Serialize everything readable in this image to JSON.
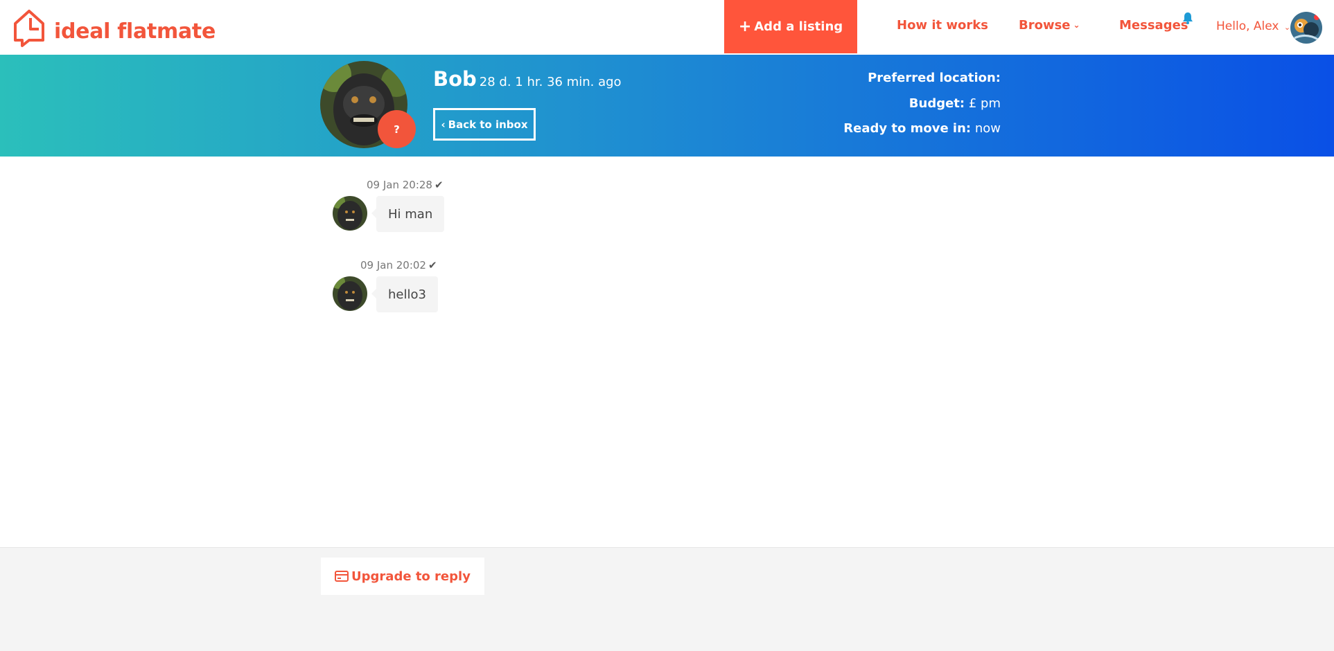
{
  "brand": {
    "name": "ideal flatmate",
    "color": "#f2553b"
  },
  "nav": {
    "add_listing": "Add a listing",
    "how_it_works": "How it works",
    "browse": "Browse",
    "messages": "Messages",
    "greeting": "Hello, Alex"
  },
  "conversation": {
    "contact_name": "Bob",
    "last_seen": "28 d. 1 hr. 36 min. ago",
    "badge": "?",
    "back_label": "Back to inbox",
    "preferred_location_label": "Preferred location:",
    "preferred_location_value": "",
    "budget_label": "Budget:",
    "budget_value": "£ pm",
    "move_in_label": "Ready to move in:",
    "move_in_value": "now"
  },
  "messages": [
    {
      "time": "09 Jan 20:28",
      "text": "Hi man"
    },
    {
      "time": "09 Jan 20:02",
      "text": "hello3"
    }
  ],
  "footer": {
    "upgrade_label": "Upgrade to reply"
  },
  "colors": {
    "accent": "#f2553b",
    "gradient_start": "#2bbfbb",
    "gradient_end": "#0a50e6",
    "bubble": "#f4f4f4"
  }
}
